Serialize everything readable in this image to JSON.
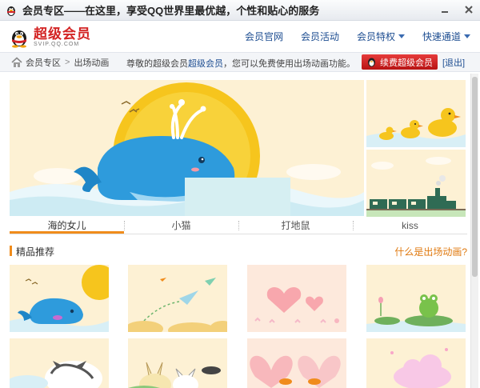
{
  "window": {
    "title": "会员专区——在这里，享受QQ世界里最优越，个性和贴心的服务",
    "controls": [
      "minimize-icon",
      "close-icon"
    ]
  },
  "logo": {
    "main": "超级会员",
    "sub": "SVIP.QQ.COM"
  },
  "nav": [
    {
      "label": "会员官网",
      "dropdown": false
    },
    {
      "label": "会员活动",
      "dropdown": false
    },
    {
      "label": "会员特权",
      "dropdown": true
    },
    {
      "label": "快速通道",
      "dropdown": true
    }
  ],
  "breadcrumb": {
    "items": [
      "会员专区",
      "出场动画"
    ],
    "separator": ">"
  },
  "notice": {
    "before": "尊敬的超级会员",
    "highlight": "超级会员",
    "after": "，您可以免费使用出场动画功能。"
  },
  "renew_button": "续费超级会员",
  "exit_link": "[退出]",
  "tabs": [
    {
      "label": "海的女儿",
      "active": true
    },
    {
      "label": "小猫",
      "active": false
    },
    {
      "label": "打地鼠",
      "active": false
    },
    {
      "label": "kiss",
      "active": false
    }
  ],
  "section": {
    "title": "精品推荐",
    "link": "什么是出场动画?"
  },
  "colors": {
    "accent_orange": "#f08c1c",
    "link_blue": "#1d4d91",
    "renew_red": "#d21e1e",
    "whale_blue": "#2e9bdc",
    "sun_yellow": "#f6c51d"
  }
}
